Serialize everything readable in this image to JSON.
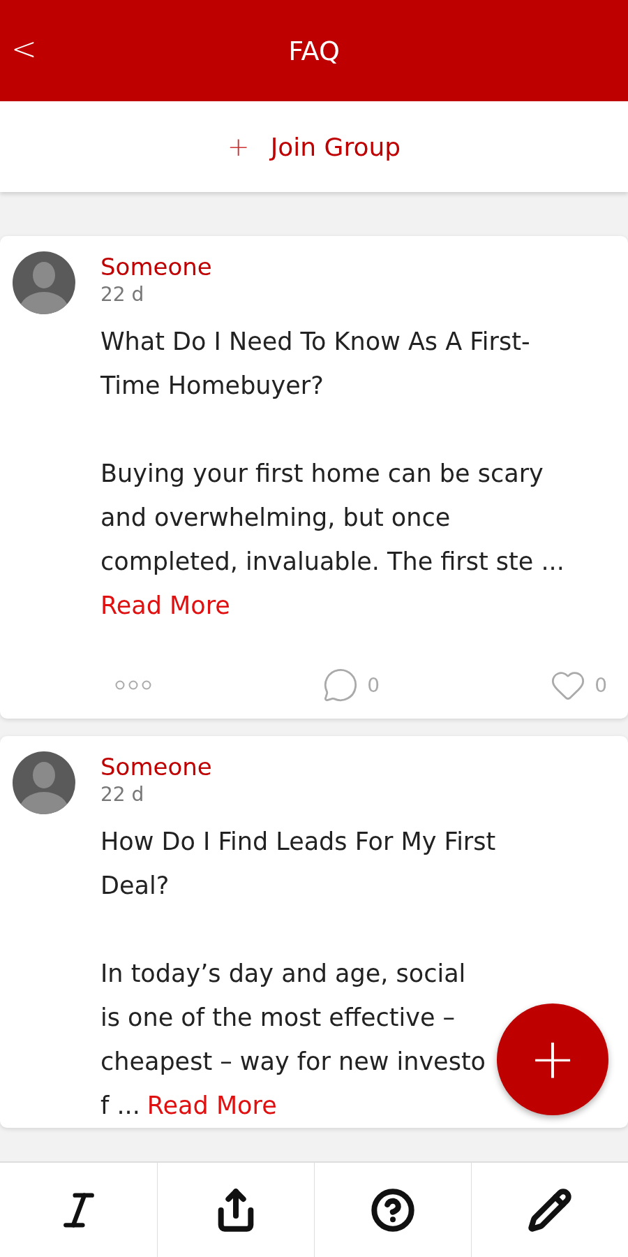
{
  "header": {
    "back": "<",
    "title": "FAQ"
  },
  "join_button": {
    "icon": "+",
    "label": "Join Group"
  },
  "posts": [
    {
      "author": "Someone",
      "time": "22 d",
      "title_lines": [
        "What Do I Need To Know As A First-",
        "Time Homebuyer?"
      ],
      "body_lines": [
        {
          "text": "Buying your first home can be scary"
        },
        {
          "text": "and overwhelming, but once"
        },
        {
          "text": "completed, invaluable. The first ste ..."
        },
        {
          "link": "Read More"
        }
      ],
      "comments": "0",
      "likes": "0",
      "liked": false
    },
    {
      "author": "Someone",
      "time": "22 d",
      "title_lines": [
        "How Do I Find Leads For My First",
        "Deal?"
      ],
      "body_lines": [
        {
          "text": "In today’s day and age, social"
        },
        {
          "text": "is one of the most effective –"
        },
        {
          "text": "cheapest – way for new investo"
        },
        {
          "text": "f ...",
          "link": "Read More"
        }
      ]
    }
  ],
  "fab": {
    "label": "+"
  },
  "toolbar": [
    {
      "kind": "italic"
    },
    {
      "kind": "share"
    },
    {
      "kind": "help"
    },
    {
      "kind": "edit"
    }
  ]
}
